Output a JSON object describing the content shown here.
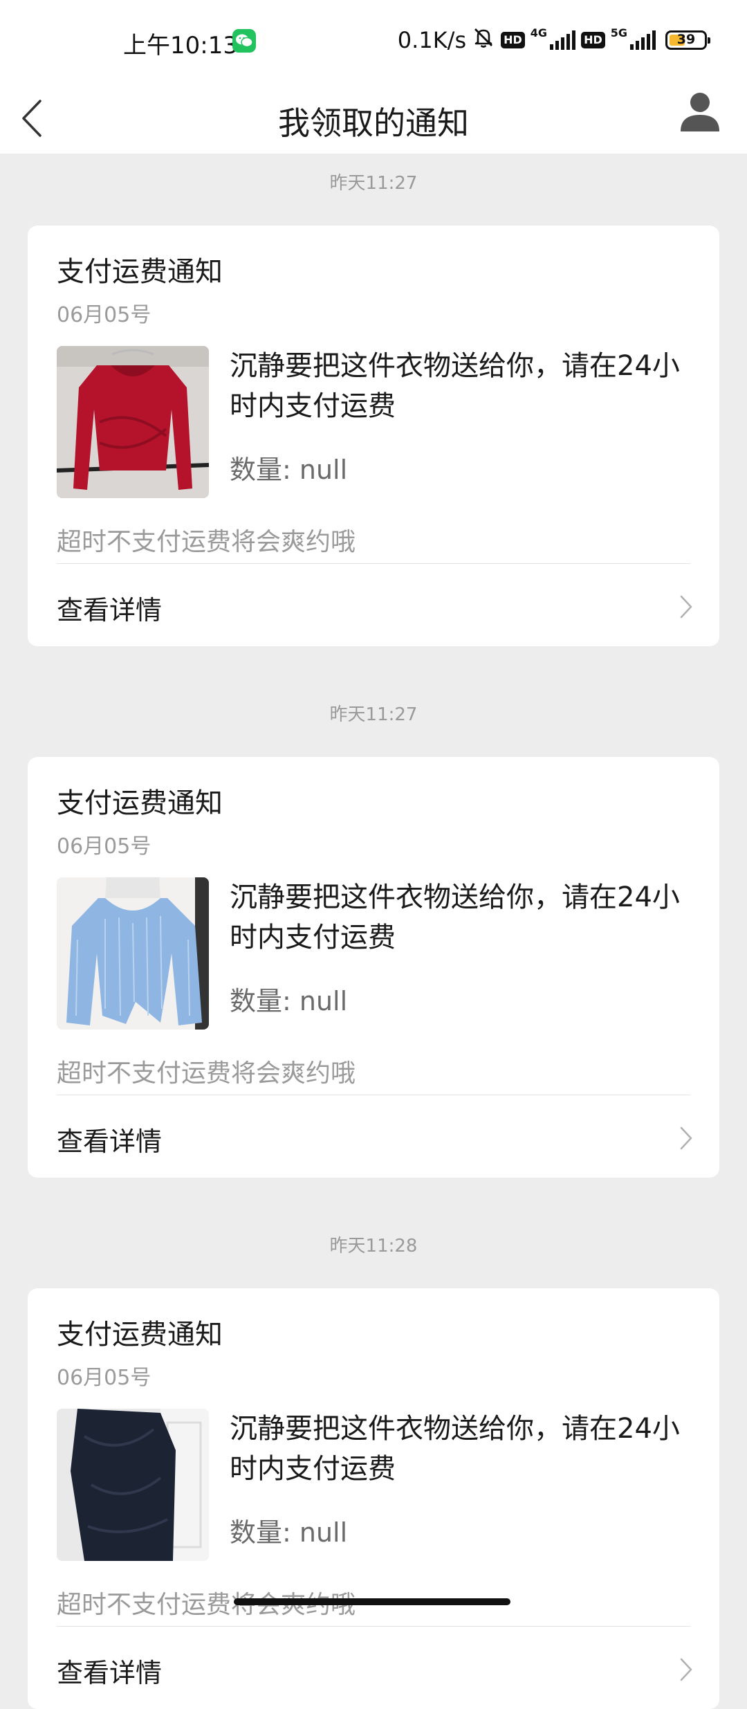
{
  "status_bar": {
    "time": "上午10:13",
    "app_badge": "wechat-icon",
    "speed": "0.1K/s",
    "hd1": "HD",
    "net1": "4G",
    "hd2": "HD",
    "net2": "5G",
    "battery": "39"
  },
  "nav": {
    "title": "我领取的通知",
    "back_icon": "chevron-left-icon",
    "profile_icon": "user-icon"
  },
  "notifications": [
    {
      "timestamp": "昨天11:27",
      "title": "支付运费通知",
      "date": "06月05号",
      "message": "沉静要把这件衣物送给你，请在24小时内支付运费",
      "quantity": "数量: null",
      "hint": "超时不支付运费将会爽约哦",
      "detail_label": "查看详情",
      "thumbnail": "red-long-sleeve-wrap-top"
    },
    {
      "timestamp": "昨天11:27",
      "title": "支付运费通知",
      "date": "06月05号",
      "message": "沉静要把这件衣物送给你，请在24小时内支付运费",
      "quantity": "数量: null",
      "hint": "超时不支付运费将会爽约哦",
      "detail_label": "查看详情",
      "thumbnail": "blue-striped-off-shoulder-blouse"
    },
    {
      "timestamp": "昨天11:28",
      "title": "支付运费通知",
      "date": "06月05号",
      "message": "沉静要把这件衣物送给你，请在24小时内支付运费",
      "quantity": "数量: null",
      "hint": "超时不支付运费将会爽约哦",
      "detail_label": "查看详情",
      "thumbnail": "black-garment"
    }
  ]
}
